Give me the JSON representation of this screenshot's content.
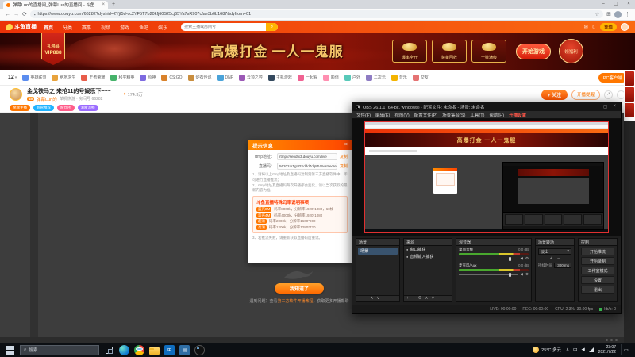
{
  "glyphs": {
    "back": "←",
    "forward": "→",
    "reload": "⟳",
    "menu": "⋮",
    "star": "☆",
    "puzzle": "⊞",
    "min": "–",
    "max": "▢",
    "close": "×",
    "newtab": "+",
    "search": "⌕",
    "caret_down": "▾",
    "mail": "✉",
    "moon": "☾",
    "more": "⋯",
    "share": "↗",
    "flame": "♦",
    "lock": "▪",
    "plus": "+",
    "minus": "−",
    "up": "∧",
    "down": "∨",
    "gear": "⚙",
    "eye": "●",
    "speaker": "◀",
    "chevron_up": "∧",
    "notif": "▭"
  },
  "browser": {
    "tab_title": "弹幕Lun的直播间_弹幕Lun的直播间 - 斗鱼",
    "url": "https://www.douyu.com/66282?dyshid=2Yjf5d-cc2YF5T7b20kfj60S25cj65Ya7sR907cfae3b0b1687&dyfrom=01"
  },
  "site": {
    "logo": "斗鱼直播",
    "nav": [
      "首页",
      "分类",
      "赛事",
      "视频",
      "游戏",
      "鱼吧",
      "娱乐"
    ],
    "search_placeholder": "搜索主播或房间号",
    "recharge": "充值",
    "banner": {
      "ribbon_line1": "礼包码",
      "ribbon_line2": "VIP888",
      "title": "高爆打金 一人一鬼服",
      "badges": [
        "爆率全开",
        "装备回收",
        "一键满级"
      ],
      "cta": "开始游戏",
      "round_badge": "领福利"
    },
    "categories": {
      "count": "12",
      "pc_btn": "PC客户端",
      "items": [
        {
          "label": "英雄联盟",
          "color": "#5b8def"
        },
        {
          "label": "绝地求生",
          "color": "#e8a33d"
        },
        {
          "label": "王者荣耀",
          "color": "#e85d4a"
        },
        {
          "label": "和平精英",
          "color": "#46b36b"
        },
        {
          "label": "原神",
          "color": "#7d6ae0"
        },
        {
          "label": "CS:GO",
          "color": "#d9822b"
        },
        {
          "label": "炉石传说",
          "color": "#c98e3f"
        },
        {
          "label": "DNF",
          "color": "#4aa3d9"
        },
        {
          "label": "云顶之弈",
          "color": "#9b59b6"
        },
        {
          "label": "主机游戏",
          "color": "#34495e"
        },
        {
          "label": "一起看",
          "color": "#f06292"
        },
        {
          "label": "颜值",
          "color": "#ff8fb1"
        },
        {
          "label": "户外",
          "color": "#58c9b9"
        },
        {
          "label": "二次元",
          "color": "#8e7cc3"
        },
        {
          "label": "音乐",
          "color": "#f4b400"
        },
        {
          "label": "交友",
          "color": "#e57373"
        }
      ]
    },
    "stream": {
      "title": "金戈铁马之 来抢11的号娱乐下~~~",
      "level": "45",
      "name": "弹幕Lun的",
      "meta": "单机热游 · 房间号 66282",
      "heat": "174.3万",
      "follow": "+ 关注",
      "remind": "开播提醒"
    },
    "tags": [
      {
        "label": "金牌主播",
        "color": "#ff7700"
      },
      {
        "label": "超管推荐",
        "color": "#1fb3ff"
      },
      {
        "label": "粉丝团",
        "color": "#ff5d8a"
      },
      {
        "label": "清晰流畅",
        "color": "#9b6cff"
      }
    ]
  },
  "dialog": {
    "title": "提示信息",
    "rtmp_label": "rtmp地址：",
    "rtmp_value": "rtmp://sendtx3.douyu.com/live",
    "code_label": "直播码：",
    "code_value": "562024r1gU2Sddd7dgMV?wsSecret=8a3f52c9&wsTime=61075f3a",
    "copy": "复制",
    "notes": [
      "1、请将以上rtmp地址及直播码复制到第三方直播软件中，即可进行直播推流；",
      "2、rtmp地址及直播码每次开播都会变化，请以当次获取的最新内容为准。"
    ],
    "warn_title": "斗鱼直播特殊码率说明事项",
    "warn_rows": [
      {
        "tag": "蓝光8M",
        "text": "码率8000k，分辨率1920*1080，60帧"
      },
      {
        "tag": "蓝光4M",
        "text": "码率4000k，分辨率1920*1080"
      },
      {
        "tag": "超清",
        "text": "码率2000k，分辨率1600*900"
      },
      {
        "tag": "高清",
        "text": "码率1200k，分辨率1280*720"
      }
    ],
    "extra_note": "3、若推流失败，请重新获取直播码后重试。",
    "confirm": "我知道了",
    "help_pre": "遇到问题？查看",
    "help_link": "第三方软件开播教程",
    "help_post": "，获取更多开播帮助"
  },
  "obs": {
    "title": "OBS 26.1.1 (64-bit, windows) - 配置文件: 未命名 - 场景: 未命名",
    "menus": [
      "文件(F)",
      "编辑(E)",
      "视图(V)",
      "配置文件(P)",
      "场景集合(S)",
      "工具(T)",
      "帮助(H)"
    ],
    "menu_extra": "开播设置",
    "scenes": {
      "title": "场景",
      "items": [
        "场景"
      ]
    },
    "sources": {
      "title": "来源",
      "items": [
        "窗口捕获",
        "音频输入捕获"
      ]
    },
    "mixer": {
      "title": "混音器",
      "channels": [
        {
          "name": "桌面音频",
          "db": "0.0 dB"
        },
        {
          "name": "麦克风/Aux",
          "db": "0.0 dB"
        }
      ]
    },
    "transitions": {
      "title": "场景转场",
      "value": "淡出",
      "duration_label": "持续时间",
      "duration": "300 ms"
    },
    "controls": {
      "title": "控制",
      "buttons": [
        "开始推流",
        "开始录制",
        "工作室模式",
        "设置",
        "退出"
      ]
    },
    "status": {
      "live": "LIVE: 00:00:00",
      "rec": "REC: 00:00:00",
      "cpu": "CPU: 2.3%, 30.00 fps",
      "kbs": "kb/s: 0"
    }
  },
  "taskbar": {
    "search": "搜索",
    "weather": "25°C 多云",
    "ime": "中",
    "time": "23:07",
    "date": "2021/7/22"
  }
}
